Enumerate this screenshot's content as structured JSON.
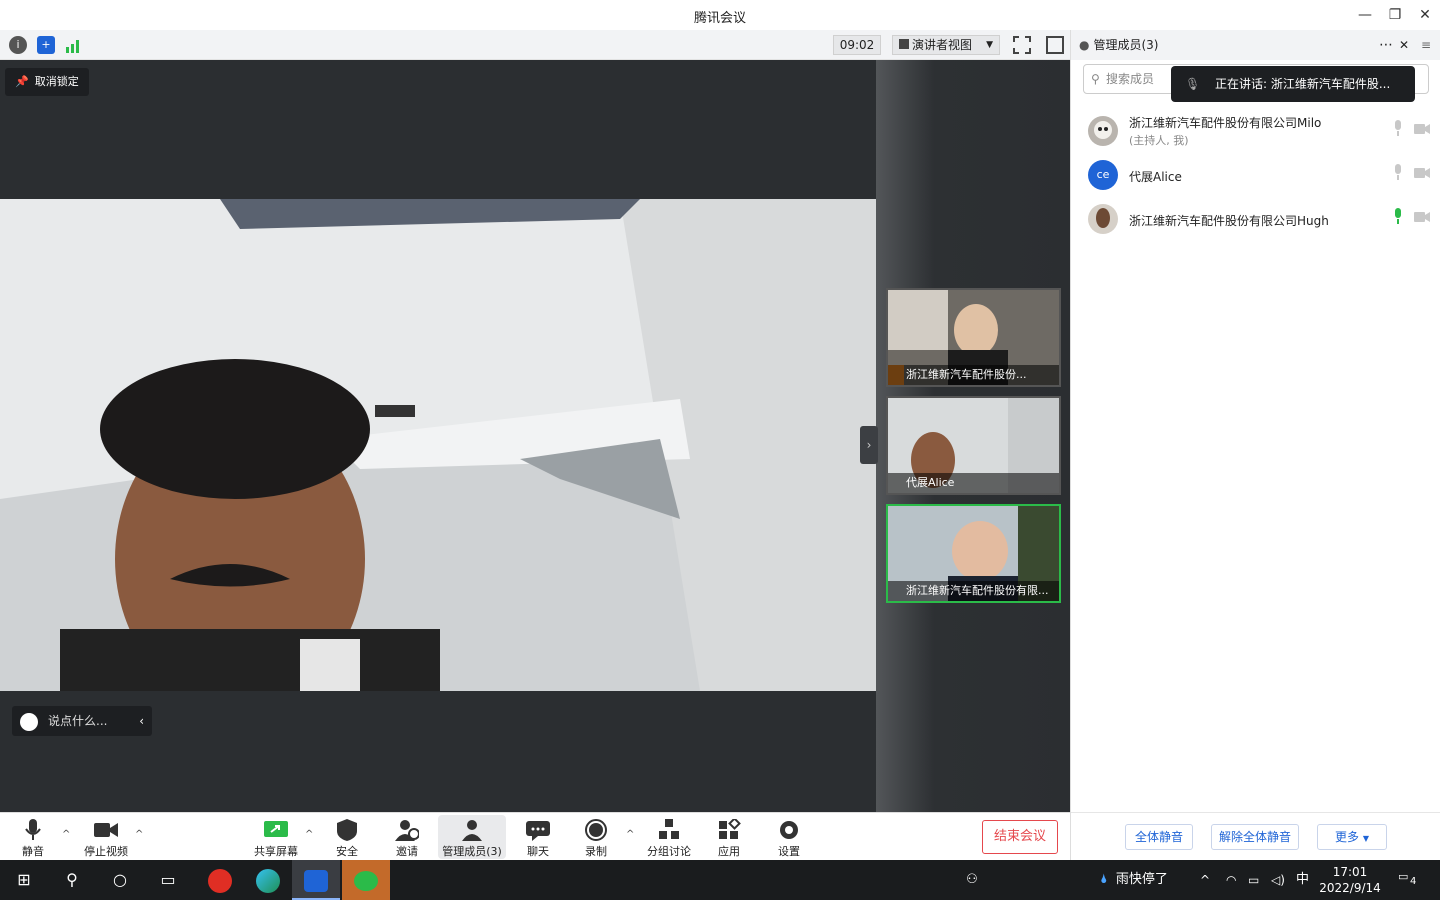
{
  "window": {
    "title": "腾讯会议"
  },
  "top": {
    "timer": "09:02",
    "view_label": "演讲者视图"
  },
  "stage": {
    "unlock_label": "取消锁定",
    "chat_placeholder": "说点什么..."
  },
  "thumbnails": [
    {
      "label": "浙江维新汽车配件股份..."
    },
    {
      "label": "代展Alice"
    },
    {
      "label": "浙江维新汽车配件股份有限..."
    }
  ],
  "panel": {
    "title": "管理成员(3)",
    "search_placeholder": "搜索成员",
    "speaking": "正在讲话: 浙江维新汽车配件股...",
    "members": [
      {
        "name": "浙江维新汽车配件股份有限公司Milo",
        "sub": "(主持人, 我)",
        "mic": "muted"
      },
      {
        "name": "代展Alice",
        "sub": "",
        "avatar": "ce",
        "mic": "muted"
      },
      {
        "name": "浙江维新汽车配件股份有限公司Hugh",
        "sub": "",
        "mic": "active"
      }
    ],
    "mute_all": "全体静音",
    "unmute_all": "解除全体静音",
    "more": "更多"
  },
  "bottom": {
    "mute": "静音",
    "stop_video": "停止视频",
    "share": "共享屏幕",
    "security": "安全",
    "invite": "邀请",
    "members": "管理成员(3)",
    "chat": "聊天",
    "record": "录制",
    "breakout": "分组讨论",
    "apps": "应用",
    "settings": "设置",
    "end": "结束会议"
  },
  "taskbar": {
    "weather": "雨快停了",
    "ime": "中",
    "time": "17:01",
    "date": "2022/9/14",
    "notif_count": "4"
  },
  "colors": {
    "accent": "#1f64d6",
    "danger": "#e5484d",
    "active_mic": "#2bbb49"
  }
}
